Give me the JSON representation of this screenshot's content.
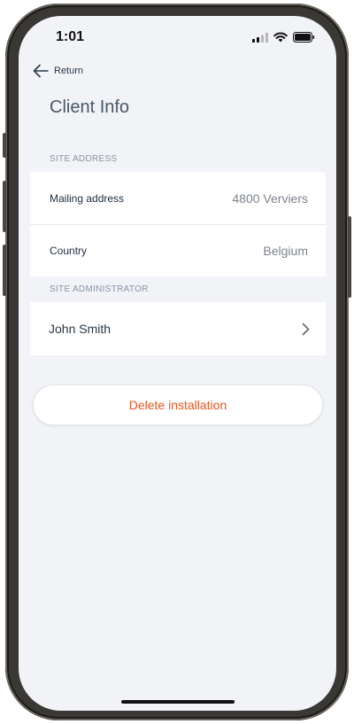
{
  "status_bar": {
    "time": "1:01",
    "icons": [
      "cellular-signal-icon",
      "wifi-icon",
      "battery-icon"
    ]
  },
  "nav": {
    "back_label": "Return",
    "back_icon": "arrow-left-icon"
  },
  "page": {
    "title": "Client Info"
  },
  "site_address": {
    "section_label": "SITE ADDRESS",
    "rows": [
      {
        "label": "Mailing address",
        "value": "4800 Verviers"
      },
      {
        "label": "Country",
        "value": "Belgium"
      }
    ]
  },
  "site_administrator": {
    "section_label": "SITE ADMINISTRATOR",
    "name": "John Smith",
    "icon": "chevron-right-icon"
  },
  "actions": {
    "delete_label": "Delete installation",
    "delete_color": "#e8541e"
  },
  "colors": {
    "screen_background": "#f1f3f7",
    "card_background": "#ffffff",
    "frame": "#3a3834"
  }
}
